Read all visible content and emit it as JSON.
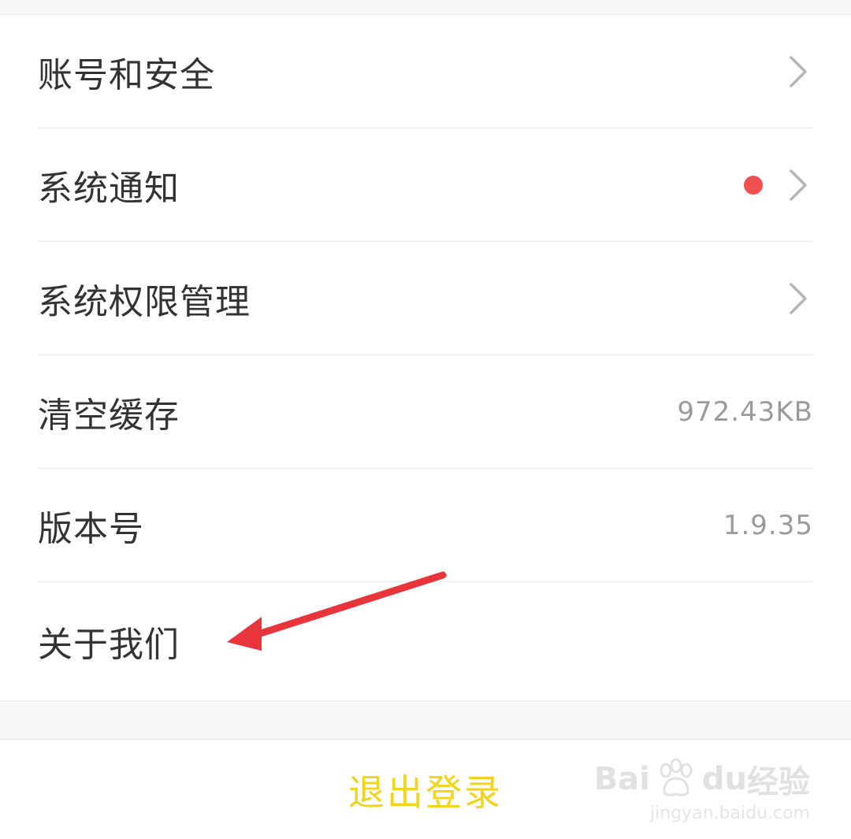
{
  "settings": {
    "rows": [
      {
        "label": "账号和安全",
        "value": "",
        "chevron": true,
        "badge": false
      },
      {
        "label": "系统通知",
        "value": "",
        "chevron": true,
        "badge": true
      },
      {
        "label": "系统权限管理",
        "value": "",
        "chevron": true,
        "badge": false
      },
      {
        "label": "清空缓存",
        "value": "972.43KB",
        "chevron": false,
        "badge": false
      },
      {
        "label": "版本号",
        "value": "1.9.35",
        "chevron": false,
        "badge": false
      },
      {
        "label": "关于我们",
        "value": "",
        "chevron": false,
        "badge": false
      }
    ]
  },
  "logout": {
    "label": "退出登录"
  },
  "watermark": {
    "brand": "Bai",
    "brand_end": "du",
    "brand_cn": "经验",
    "url": "jingyan.baidu.com"
  },
  "colors": {
    "accent_yellow": "#f2d41c",
    "badge_red": "#f05050",
    "annotation_red": "#e8353b"
  }
}
